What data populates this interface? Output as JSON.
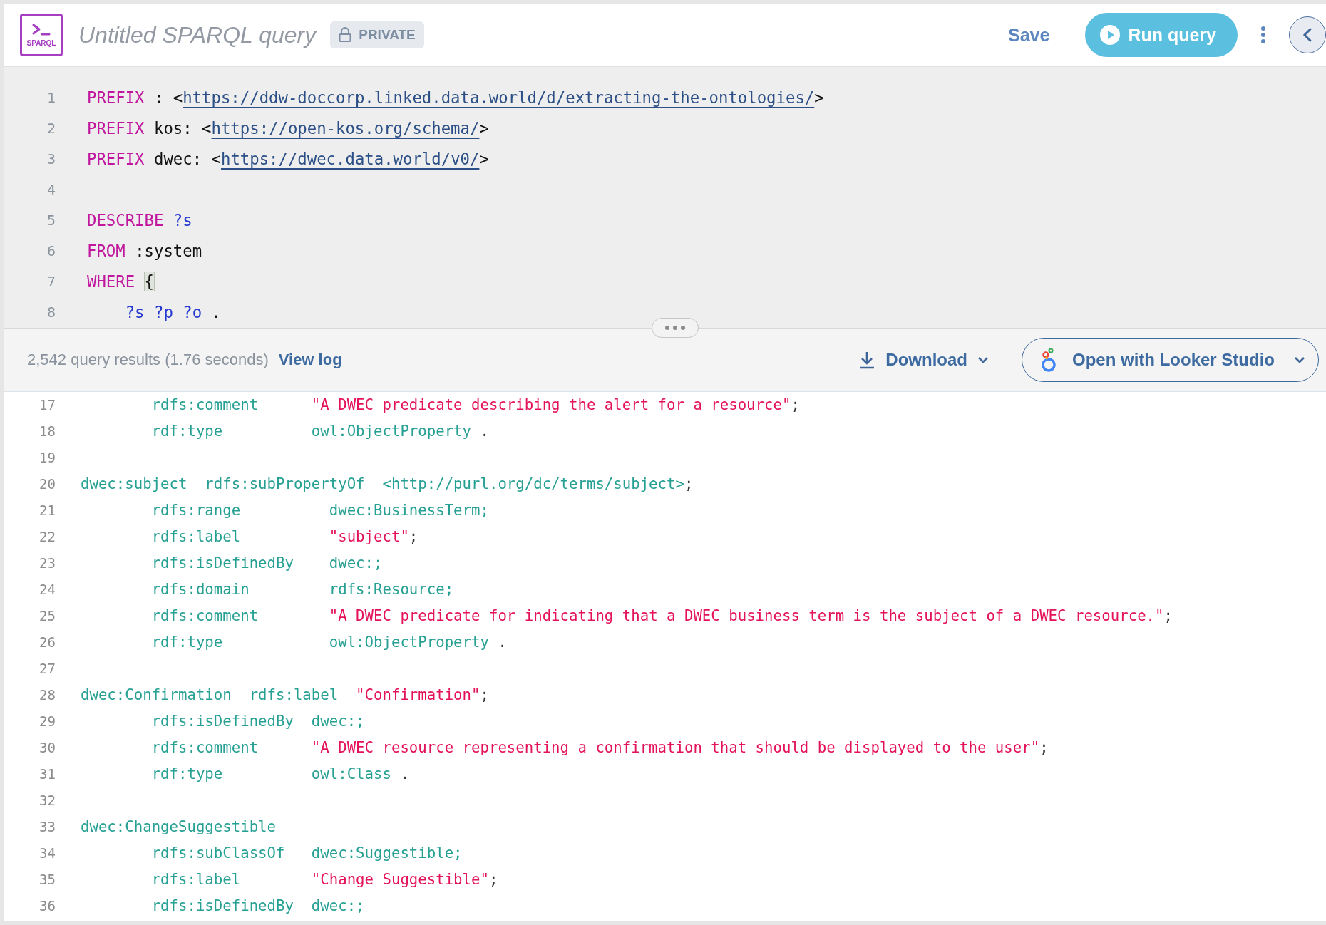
{
  "app": {
    "logo_label": "SPARQL",
    "title": "Untitled SPARQL query",
    "visibility": "PRIVATE"
  },
  "toolbar": {
    "save": "Save",
    "run": "Run query"
  },
  "editor": {
    "lines": [
      {
        "number": "1",
        "tokens": [
          {
            "kind": "kw",
            "text": "PREFIX"
          },
          {
            "kind": "plain",
            "text": " : <"
          },
          {
            "kind": "iri",
            "text": "https://ddw-doccorp.linked.data.world/d/extracting-the-ontologies/"
          },
          {
            "kind": "plain",
            "text": ">"
          }
        ]
      },
      {
        "number": "2",
        "tokens": [
          {
            "kind": "kw",
            "text": "PREFIX"
          },
          {
            "kind": "plain",
            "text": " kos: <"
          },
          {
            "kind": "iri",
            "text": "https://open-kos.org/schema/"
          },
          {
            "kind": "plain",
            "text": ">"
          }
        ]
      },
      {
        "number": "3",
        "tokens": [
          {
            "kind": "kw",
            "text": "PREFIX"
          },
          {
            "kind": "plain",
            "text": " dwec: <"
          },
          {
            "kind": "iri",
            "text": "https://dwec.data.world/v0/"
          },
          {
            "kind": "plain",
            "text": ">"
          }
        ]
      },
      {
        "number": "4"
      },
      {
        "number": "5",
        "tokens": [
          {
            "kind": "kw",
            "text": "DESCRIBE "
          },
          {
            "kind": "var",
            "text": "?s"
          }
        ]
      },
      {
        "number": "6",
        "tokens": [
          {
            "kind": "kw",
            "text": "FROM"
          },
          {
            "kind": "plain",
            "text": " :system"
          }
        ]
      },
      {
        "number": "7",
        "tokens": [
          {
            "kind": "kw",
            "text": "WHERE "
          },
          {
            "kind": "matched",
            "text": "{"
          }
        ]
      },
      {
        "number": "8",
        "tokens": [
          {
            "kind": "var",
            "text": "    ?s ?p ?o"
          },
          {
            "kind": "plain",
            "text": " ."
          }
        ]
      }
    ]
  },
  "results": {
    "summary": "2,542 query results (1.76 seconds)",
    "view_log": "View log",
    "download": "Download",
    "open_with": "Open with Looker Studio",
    "lines": [
      {
        "number": "17",
        "tokens": [
          {
            "kind": "term",
            "text": "        rdfs:comment      "
          },
          {
            "kind": "str",
            "text": "\"A DWEC predicate describing the alert for a resource\""
          },
          {
            "kind": "punct",
            "text": ";"
          }
        ]
      },
      {
        "number": "18",
        "tokens": [
          {
            "kind": "term",
            "text": "        rdf:type          owl:ObjectProperty"
          },
          {
            "kind": "punct",
            "text": " ."
          }
        ]
      },
      {
        "number": "19"
      },
      {
        "number": "20",
        "tokens": [
          {
            "kind": "term",
            "text": "dwec:subject  rdfs:subPropertyOf  <http://purl.org/dc/terms/subject>"
          },
          {
            "kind": "punct",
            "text": ";"
          }
        ]
      },
      {
        "number": "21",
        "tokens": [
          {
            "kind": "term",
            "text": "        rdfs:range          dwec:BusinessTerm;"
          }
        ]
      },
      {
        "number": "22",
        "tokens": [
          {
            "kind": "term",
            "text": "        rdfs:label          "
          },
          {
            "kind": "str",
            "text": "\"subject\""
          },
          {
            "kind": "punct",
            "text": ";"
          }
        ]
      },
      {
        "number": "23",
        "tokens": [
          {
            "kind": "term",
            "text": "        rdfs:isDefinedBy    dwec:;"
          }
        ]
      },
      {
        "number": "24",
        "tokens": [
          {
            "kind": "term",
            "text": "        rdfs:domain         rdfs:Resource;"
          }
        ]
      },
      {
        "number": "25",
        "tokens": [
          {
            "kind": "term",
            "text": "        rdfs:comment        "
          },
          {
            "kind": "str",
            "text": "\"A DWEC predicate for indicating that a DWEC business term is the subject of a DWEC resource.\""
          },
          {
            "kind": "punct",
            "text": ";"
          }
        ]
      },
      {
        "number": "26",
        "tokens": [
          {
            "kind": "term",
            "text": "        rdf:type            owl:ObjectProperty"
          },
          {
            "kind": "punct",
            "text": " ."
          }
        ]
      },
      {
        "number": "27"
      },
      {
        "number": "28",
        "tokens": [
          {
            "kind": "term",
            "text": "dwec:Confirmation  rdfs:label  "
          },
          {
            "kind": "str",
            "text": "\"Confirmation\""
          },
          {
            "kind": "punct",
            "text": ";"
          }
        ]
      },
      {
        "number": "29",
        "tokens": [
          {
            "kind": "term",
            "text": "        rdfs:isDefinedBy  dwec:;"
          }
        ]
      },
      {
        "number": "30",
        "tokens": [
          {
            "kind": "term",
            "text": "        rdfs:comment      "
          },
          {
            "kind": "str",
            "text": "\"A DWEC resource representing a confirmation that should be displayed to the user\""
          },
          {
            "kind": "punct",
            "text": ";"
          }
        ]
      },
      {
        "number": "31",
        "tokens": [
          {
            "kind": "term",
            "text": "        rdf:type          owl:Class"
          },
          {
            "kind": "punct",
            "text": " ."
          }
        ]
      },
      {
        "number": "32"
      },
      {
        "number": "33",
        "tokens": [
          {
            "kind": "term",
            "text": "dwec:ChangeSuggestible"
          }
        ]
      },
      {
        "number": "34",
        "tokens": [
          {
            "kind": "term",
            "text": "        rdfs:subClassOf   dwec:Suggestible;"
          }
        ]
      },
      {
        "number": "35",
        "tokens": [
          {
            "kind": "term",
            "text": "        rdfs:label        "
          },
          {
            "kind": "str",
            "text": "\"Change Suggestible\""
          },
          {
            "kind": "punct",
            "text": ";"
          }
        ]
      },
      {
        "number": "36",
        "tokens": [
          {
            "kind": "term",
            "text": "        rdfs:isDefinedBy  dwec:;"
          }
        ]
      }
    ]
  }
}
